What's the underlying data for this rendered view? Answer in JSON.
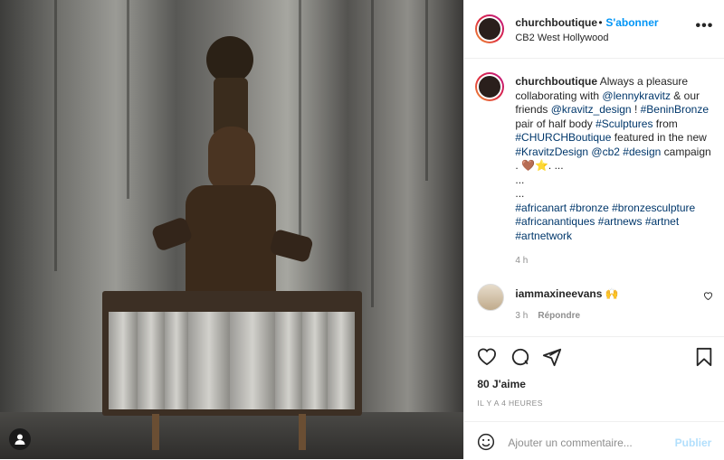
{
  "post": {
    "username": "churchboutique",
    "follow_label": "S'abonner",
    "dot": "•",
    "location": "CB2 West Hollywood",
    "more_label": "•••"
  },
  "caption": {
    "lines": [
      [
        "Always a pleasure"
      ],
      [
        "collaborating with ",
        "@lennykravitz",
        " & our"
      ],
      [
        "friends ",
        "@kravitz_design",
        " ! ",
        "#BeninBronze"
      ],
      [
        "pair of half body ",
        "#Sculptures",
        " from"
      ],
      [
        "#CHURCHBoutique",
        " featured in the new"
      ],
      [
        "#KravitzDesign",
        " ",
        "@cb2",
        " ",
        "#design",
        " campaign"
      ],
      [
        ". 🤎⭐. ..."
      ],
      [
        "..."
      ],
      [
        "..."
      ],
      [
        "#africanart",
        " ",
        "#bronze",
        " ",
        "#bronzesculpture"
      ],
      [
        "#africanantiques",
        " ",
        "#artnews",
        " ",
        "#artnet"
      ],
      [
        "#artnetwork"
      ]
    ],
    "time": "4 h"
  },
  "comment": {
    "username": "iammaxineevans",
    "emoji": "🙌",
    "time": "3 h",
    "reply_label": "Répondre"
  },
  "actions": {
    "likes": "80 J'aime",
    "ago": "IL Y A 4 HEURES",
    "add_comment_placeholder": "Ajouter un commentaire...",
    "post_label": "Publier"
  },
  "colors": {
    "link": "#00376b",
    "follow": "#0095f6",
    "muted": "#8e8e8e"
  }
}
